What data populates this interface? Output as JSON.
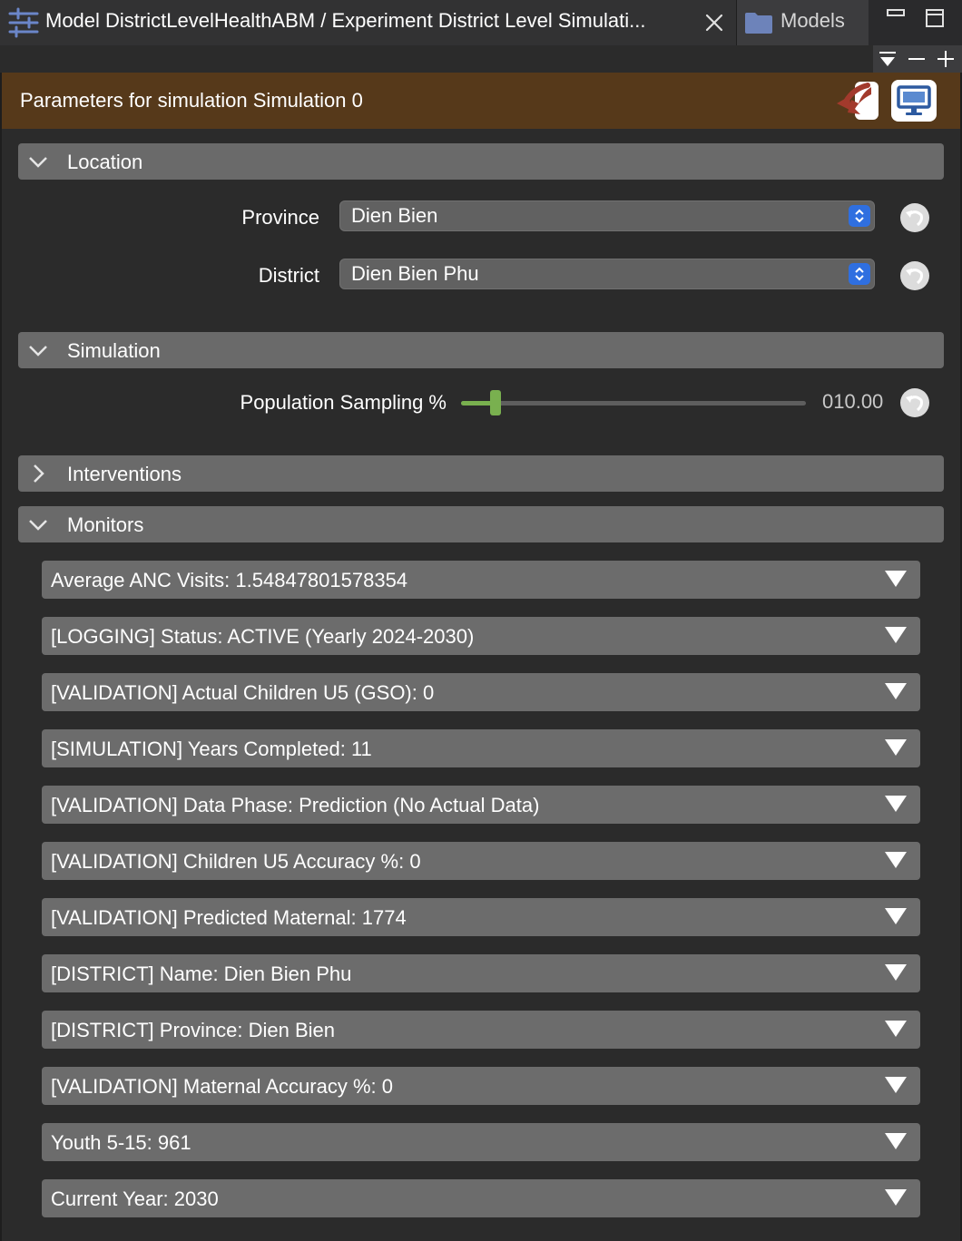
{
  "tabs": {
    "active_title": "Model DistrictLevelHealthABM / Experiment District Level Simulati...",
    "models_label": "Models"
  },
  "header": {
    "title": "Parameters for simulation Simulation 0"
  },
  "sections": {
    "location": "Location",
    "simulation": "Simulation",
    "interventions": "Interventions",
    "monitors": "Monitors"
  },
  "location": {
    "province_label": "Province",
    "province_value": "Dien Bien",
    "district_label": "District",
    "district_value": "Dien Bien Phu"
  },
  "simulation": {
    "sampling_label": "Population Sampling %",
    "sampling_value": "010.00",
    "sampling_fraction": 0.1
  },
  "monitors": [
    "Average ANC Visits: 1.54847801578354",
    "[LOGGING] Status: ACTIVE (Yearly 2024-2030)",
    "[VALIDATION] Actual Children U5 (GSO): 0",
    "[SIMULATION] Years Completed: 11",
    "[VALIDATION] Data Phase: Prediction (No Actual Data)",
    "[VALIDATION] Children U5 Accuracy %: 0",
    "[VALIDATION] Predicted Maternal: 1774",
    "[DISTRICT] Name: Dien Bien Phu",
    "[DISTRICT] Province: Dien Bien",
    "[VALIDATION] Maternal Accuracy %: 0",
    "Youth 5-15: 961",
    "Current Year: 2030"
  ],
  "colors": {
    "header_bg": "#56391a",
    "slider_accent": "#79b04f",
    "stepper_blue": "#2f6fe0"
  }
}
